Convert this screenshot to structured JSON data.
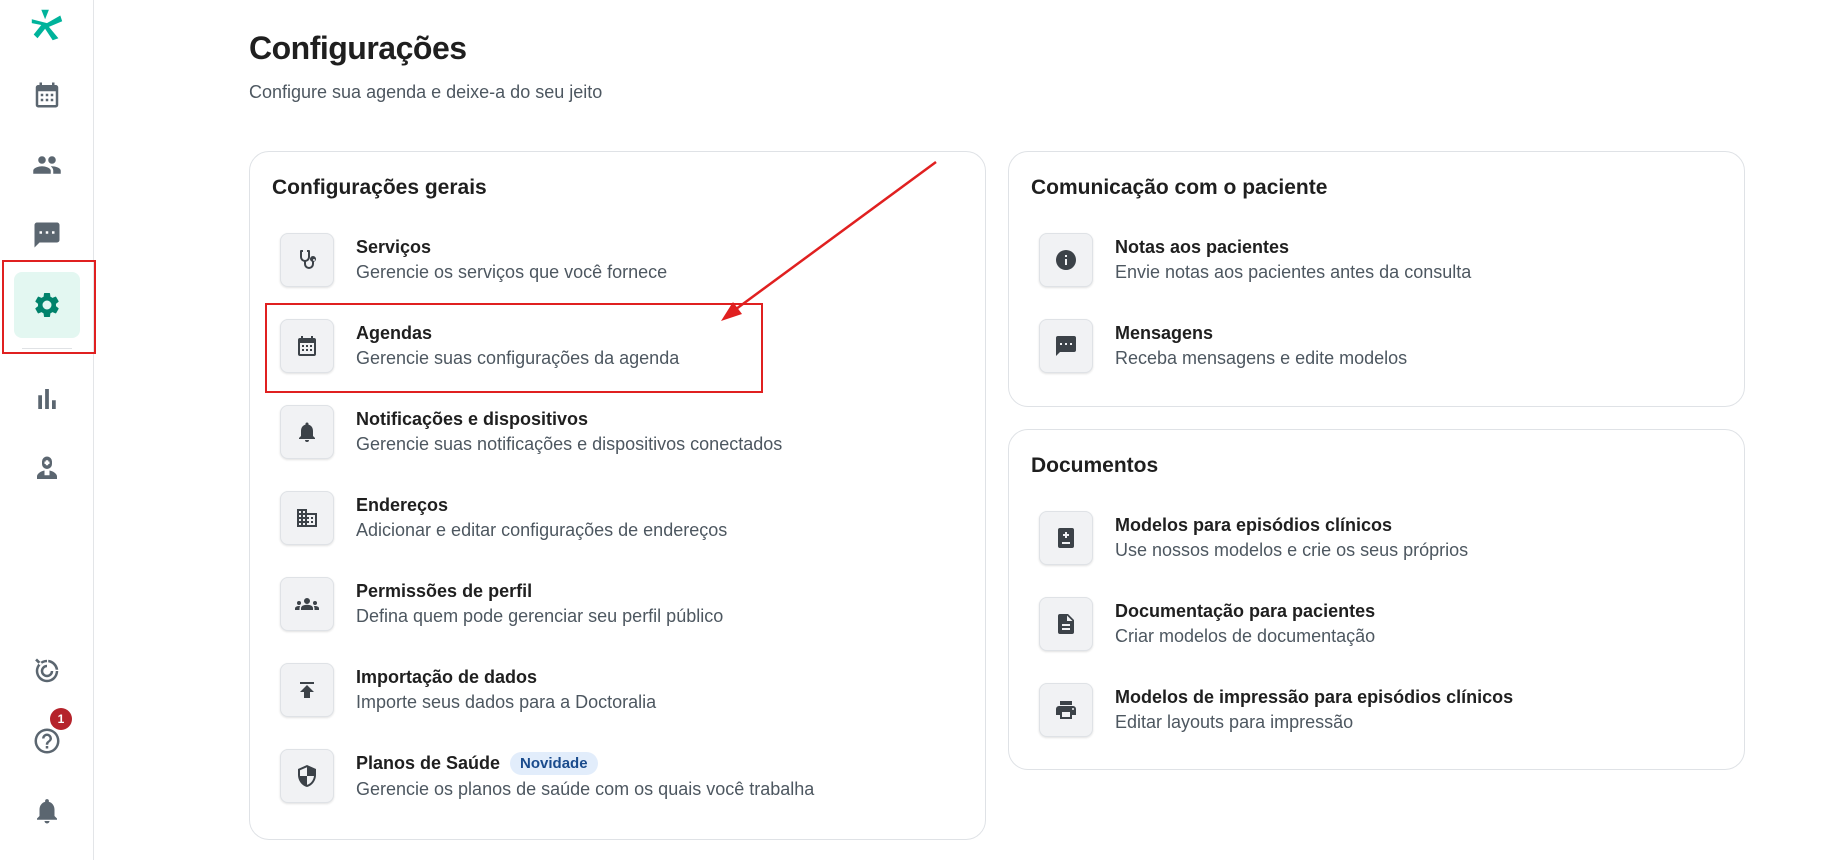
{
  "header": {
    "title": "Configurações",
    "subtitle": "Configure sua agenda e deixe-a do seu jeito"
  },
  "sidebar": {
    "items": [
      {
        "icon": "logo-icon"
      },
      {
        "icon": "calendar-icon"
      },
      {
        "icon": "patients-icon"
      },
      {
        "icon": "messages-icon"
      },
      {
        "icon": "settings-icon",
        "active": true
      },
      {
        "icon": "stats-icon"
      },
      {
        "icon": "doctor-icon"
      },
      {
        "icon": "progress-icon"
      },
      {
        "icon": "help-icon",
        "badge": "1"
      },
      {
        "icon": "bell-icon"
      }
    ],
    "help_badge": "1"
  },
  "general": {
    "title": "Configurações gerais",
    "items": [
      {
        "title": "Serviços",
        "desc": "Gerencie os serviços que você fornece",
        "icon": "stethoscope-icon"
      },
      {
        "title": "Agendas",
        "desc": "Gerencie suas configurações da agenda",
        "icon": "calendar-icon"
      },
      {
        "title": "Notificações e dispositivos",
        "desc": "Gerencie suas notificações e dispositivos conectados",
        "icon": "bell-icon"
      },
      {
        "title": "Endereços",
        "desc": "Adicionar e editar configurações de endereços",
        "icon": "building-icon"
      },
      {
        "title": "Permissões de perfil",
        "desc": "Defina quem pode gerenciar seu perfil público",
        "icon": "group-icon"
      },
      {
        "title": "Importação de dados",
        "desc": "Importe seus dados para a Doctoralia",
        "icon": "upload-icon"
      },
      {
        "title": "Planos de Saúde",
        "desc": "Gerencie os planos de saúde com os quais você trabalha",
        "icon": "shield-icon",
        "badge": "Novidade"
      }
    ]
  },
  "communication": {
    "title": "Comunicação com o paciente",
    "items": [
      {
        "title": "Notas aos pacientes",
        "desc": "Envie notas aos pacientes antes da consulta",
        "icon": "info-icon"
      },
      {
        "title": "Mensagens",
        "desc": "Receba mensagens e edite modelos",
        "icon": "chat-icon"
      }
    ]
  },
  "documents": {
    "title": "Documentos",
    "items": [
      {
        "title": "Modelos para episódios clínicos",
        "desc": "Use nossos modelos e crie os seus próprios",
        "icon": "medical-book-icon"
      },
      {
        "title": "Documentação para pacientes",
        "desc": "Criar modelos de documentação",
        "icon": "document-icon"
      },
      {
        "title": "Modelos de impressão para episódios clínicos",
        "desc": "Editar layouts para impressão",
        "icon": "printer-icon"
      }
    ]
  },
  "colors": {
    "accent": "#00b39b",
    "active_bg": "#e3f7f1",
    "annotation": "#e02020",
    "badge": "#b5232b"
  }
}
